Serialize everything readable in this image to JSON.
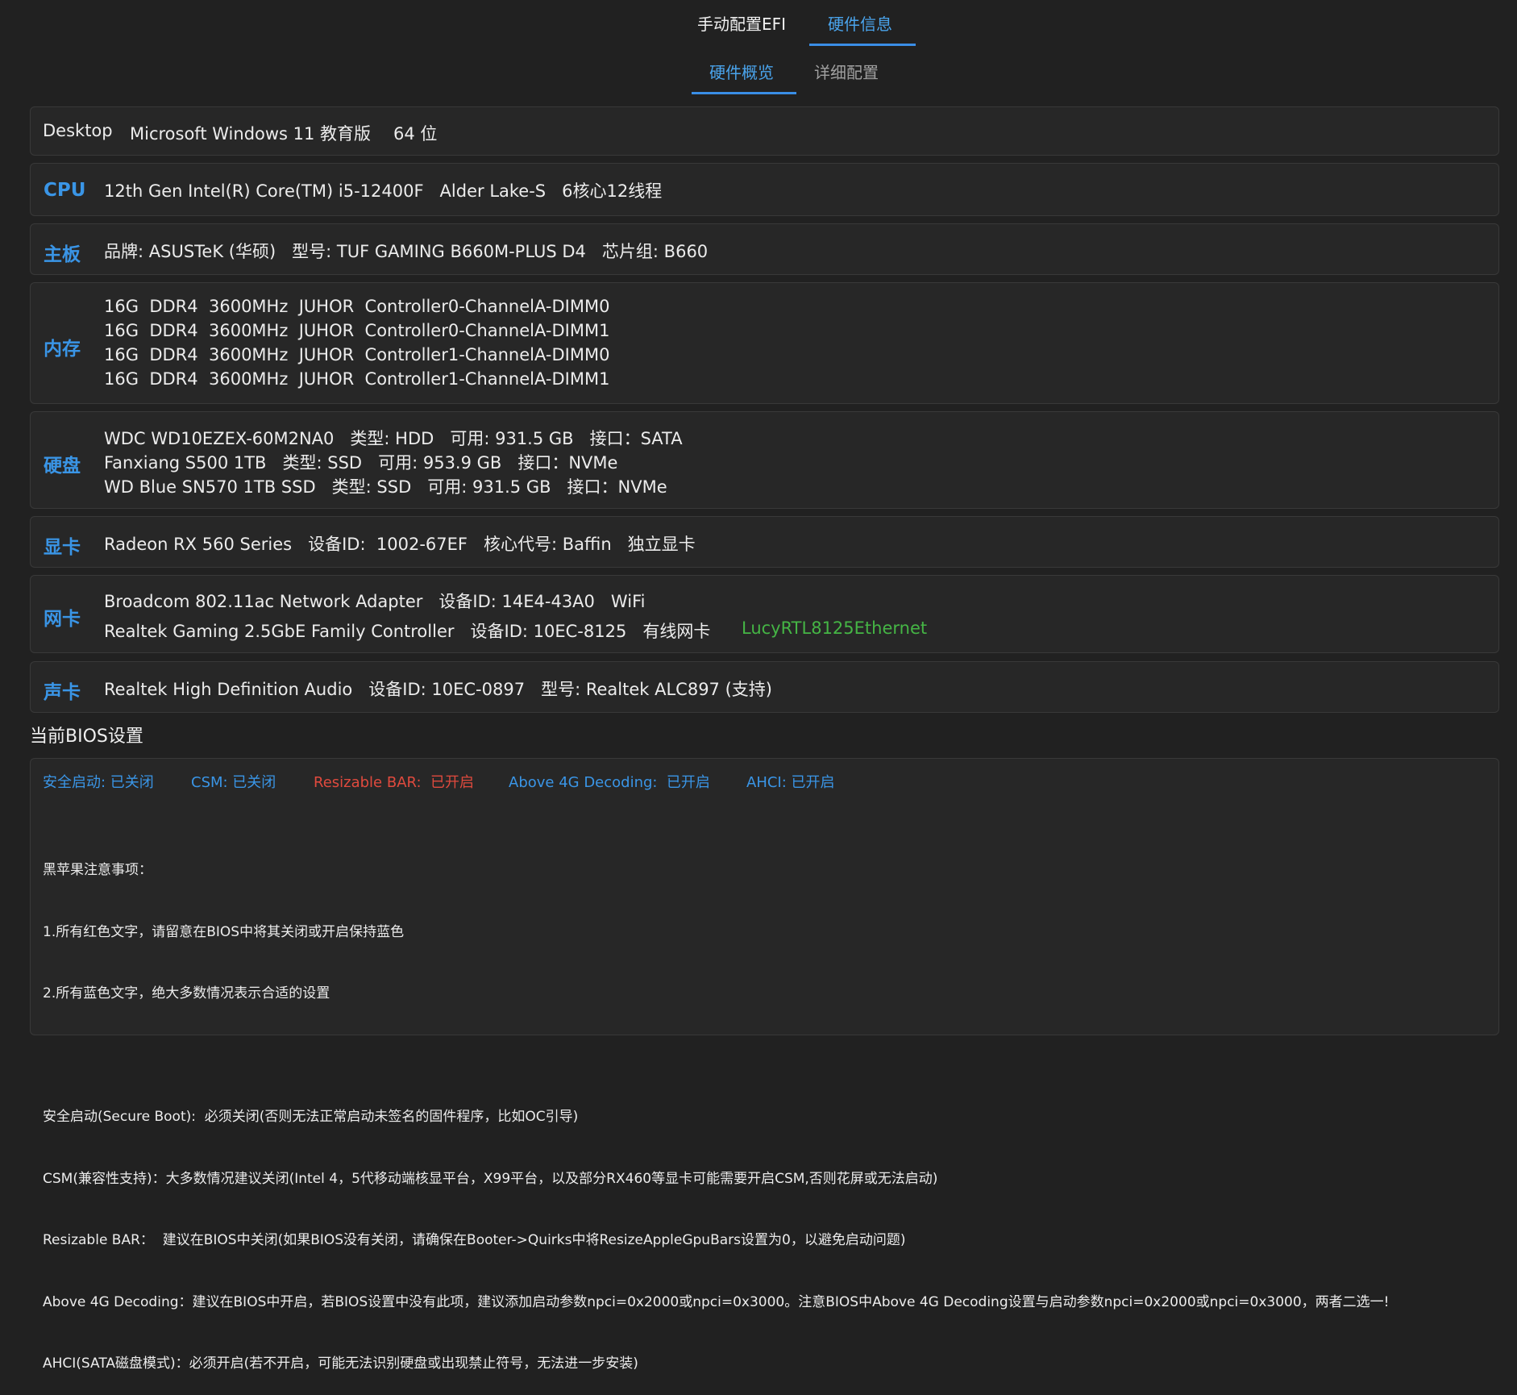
{
  "tabs_top": {
    "manual_efi": "手动配置EFI",
    "hardware_info": "硬件信息"
  },
  "tabs_sub": {
    "overview": "硬件概览",
    "detail": "详细配置"
  },
  "system": {
    "type": "Desktop",
    "os": "Microsoft Windows 11 教育版",
    "bits": "64 位"
  },
  "cpu": {
    "label": "CPU",
    "text": "12th Gen Intel(R) Core(TM) i5-12400F   Alder Lake-S   6核心12线程"
  },
  "motherboard": {
    "label": "主板",
    "text": "品牌: ASUSTeK (华硕)   型号: TUF GAMING B660M-PLUS D4   芯片组: B660"
  },
  "memory": {
    "label": "内存",
    "lines": [
      "16G  DDR4  3600MHz  JUHOR  Controller0-ChannelA-DIMM0",
      "16G  DDR4  3600MHz  JUHOR  Controller0-ChannelA-DIMM1",
      "16G  DDR4  3600MHz  JUHOR  Controller1-ChannelA-DIMM0",
      "16G  DDR4  3600MHz  JUHOR  Controller1-ChannelA-DIMM1"
    ]
  },
  "disk": {
    "label": "硬盘",
    "lines": [
      "WDC WD10EZEX-60M2NA0   类型: HDD   可用: 931.5 GB   接口：SATA",
      "Fanxiang S500 1TB   类型: SSD   可用: 953.9 GB   接口：NVMe",
      "WD Blue SN570 1TB SSD   类型: SSD   可用: 931.5 GB   接口：NVMe"
    ]
  },
  "gpu": {
    "label": "显卡",
    "text": "Radeon RX 560 Series   设备ID:  1002-67EF   核心代号: Baffin   独立显卡"
  },
  "network": {
    "label": "网卡",
    "line1": "Broadcom 802.11ac Network Adapter   设备ID: 14E4-43A0   WiFi",
    "line2": "Realtek Gaming 2.5GbE Family Controller   设备ID: 10EC-8125   有线网卡",
    "driver": "LucyRTL8125Ethernet"
  },
  "audio": {
    "label": "声卡",
    "text": "Realtek High Definition Audio   设备ID: 10EC-0897   型号: Realtek ALC897 (支持)"
  },
  "bios": {
    "title": "当前BIOS设置",
    "secure_boot": "安全启动: 已关闭",
    "csm": "CSM: 已关闭",
    "resizable_bar": "Resizable BAR:  已开启",
    "above4g": "Above 4G Decoding:  已开启",
    "ahci": "AHCI: 已开启",
    "notes": [
      "黑苹果注意事项：",
      "1.所有红色文字，请留意在BIOS中将其关闭或开启保持蓝色",
      "2.所有蓝色文字，绝大多数情况表示合适的设置",
      "",
      "安全启动(Secure Boot):  必须关闭(否则无法正常启动未签名的固件程序，比如OC引导)",
      "CSM(兼容性支持)：大多数情况建议关闭(Intel 4，5代移动端核显平台，X99平台，以及部分RX460等显卡可能需要开启CSM,否则花屏或无法启动)",
      "Resizable BAR：  建议在BIOS中关闭(如果BIOS没有关闭，请确保在Booter->Quirks中将ResizeAppleGpuBars设置为0，以避免启动问题)",
      "Above 4G Decoding：建议在BIOS中开启，若BIOS设置中没有此项，建议添加启动参数npci=0x2000或npci=0x3000。注意BIOS中Above 4G Decoding设置与启动参数npci=0x2000或npci=0x3000，两者二选一!",
      "AHCI(SATA磁盘模式)：必须开启(若不开启，可能无法识别硬盘或出现禁止符号，无法进一步安装)"
    ]
  }
}
